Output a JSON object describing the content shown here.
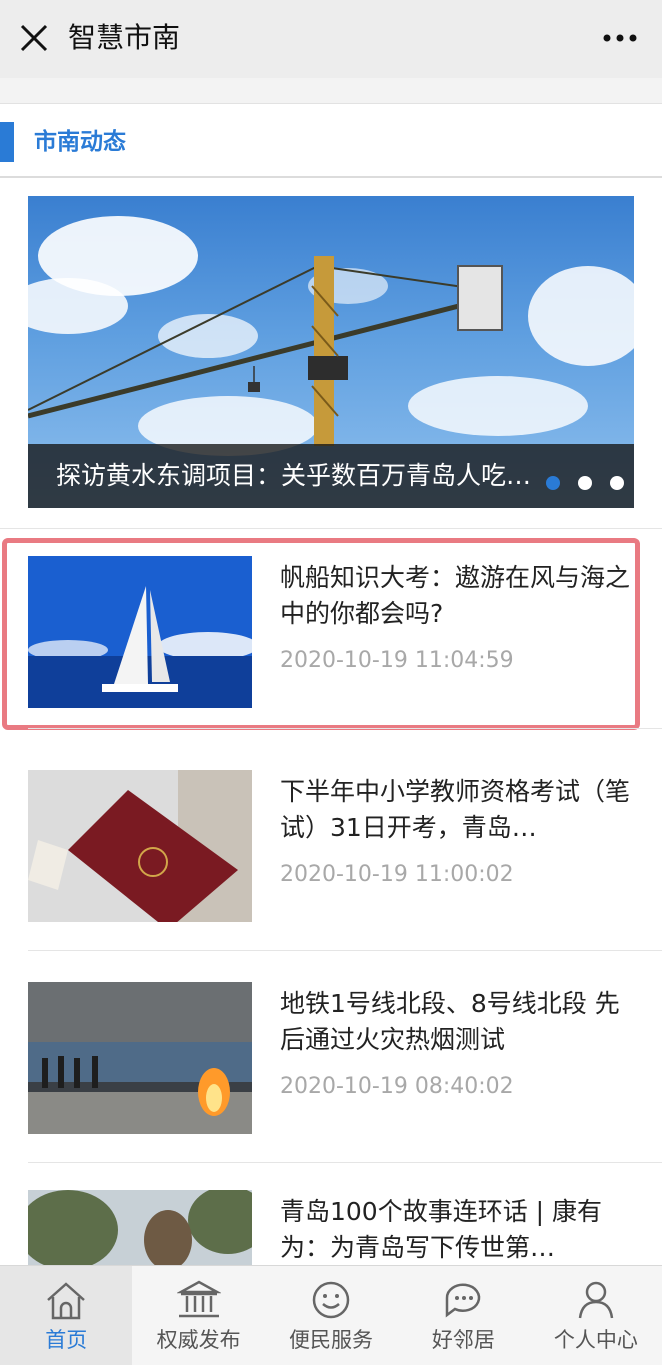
{
  "app": {
    "title": "智慧市南"
  },
  "section": {
    "title": "市南动态"
  },
  "banner": {
    "caption": "探访黄水东调项目：关乎数百万青岛人吃…",
    "slide_count": 3,
    "active_slide": 1
  },
  "news": [
    {
      "title": "帆船知识大考：遨游在风与海之中的你都会吗?",
      "time": "2020-10-19 11:04:59",
      "thumb_icon": "sailboat-photo"
    },
    {
      "title": "下半年中小学教师资格考试（笔试）31日开考，青岛…",
      "time": "2020-10-19 11:00:02",
      "thumb_icon": "certificate-photo"
    },
    {
      "title": "地铁1号线北段、8号线北段 先后通过火灾热烟测试",
      "time": "2020-10-19 08:40:02",
      "thumb_icon": "fire-test-photo"
    },
    {
      "title": "青岛100个故事连环话 | 康有为：为青岛写下传世第…",
      "time": "",
      "thumb_icon": "statue-photo"
    }
  ],
  "tabs": [
    {
      "label": "首页",
      "icon": "home-icon",
      "active": true
    },
    {
      "label": "权威发布",
      "icon": "building-icon",
      "active": false
    },
    {
      "label": "便民服务",
      "icon": "smile-icon",
      "active": false
    },
    {
      "label": "好邻居",
      "icon": "chat-icon",
      "active": false
    },
    {
      "label": "个人中心",
      "icon": "person-icon",
      "active": false
    }
  ],
  "colors": {
    "accent": "#2a7bd6",
    "highlight": "#e97a82",
    "muted": "#a8a8a8"
  }
}
